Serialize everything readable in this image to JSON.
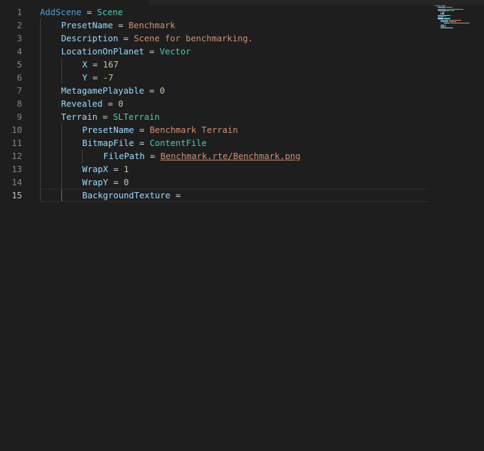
{
  "editor": {
    "lines": [
      {
        "number": "1",
        "indent": 0,
        "key": "AddScene",
        "key_class": "tok-top",
        "op": " = ",
        "value": "Scene",
        "value_class": "tok-type"
      },
      {
        "number": "2",
        "indent": 1,
        "key": "PresetName",
        "key_class": "tok-key",
        "op": " = ",
        "value": "Benchmark",
        "value_class": "tok-str"
      },
      {
        "number": "3",
        "indent": 1,
        "key": "Description",
        "key_class": "tok-key",
        "op": " = ",
        "value": "Scene for benchmarking.",
        "value_class": "tok-str"
      },
      {
        "number": "4",
        "indent": 1,
        "key": "LocationOnPlanet",
        "key_class": "tok-key",
        "op": " = ",
        "value": "Vector",
        "value_class": "tok-type"
      },
      {
        "number": "5",
        "indent": 2,
        "key": "X",
        "key_class": "tok-key",
        "op": " = ",
        "value": "167",
        "value_class": "tok-num"
      },
      {
        "number": "6",
        "indent": 2,
        "key": "Y",
        "key_class": "tok-key",
        "op": " = ",
        "value": "-7",
        "value_class": "tok-num"
      },
      {
        "number": "7",
        "indent": 1,
        "key": "MetagamePlayable",
        "key_class": "tok-key",
        "op": " = ",
        "value": "0",
        "value_class": "tok-num"
      },
      {
        "number": "8",
        "indent": 1,
        "key": "Revealed",
        "key_class": "tok-key",
        "op": " = ",
        "value": "0",
        "value_class": "tok-num"
      },
      {
        "number": "9",
        "indent": 1,
        "key": "Terrain",
        "key_class": "tok-key",
        "op": " = ",
        "value": "SLTerrain",
        "value_class": "tok-type"
      },
      {
        "number": "10",
        "indent": 2,
        "key": "PresetName",
        "key_class": "tok-key",
        "op": " = ",
        "value": "Benchmark Terrain",
        "value_class": "tok-str"
      },
      {
        "number": "11",
        "indent": 2,
        "key": "BitmapFile",
        "key_class": "tok-key",
        "op": " = ",
        "value": "ContentFile",
        "value_class": "tok-type"
      },
      {
        "number": "12",
        "indent": 3,
        "key": "FilePath",
        "key_class": "tok-key",
        "op": " = ",
        "value": "Benchmark.rte/Benchmark.png",
        "value_class": "tok-link"
      },
      {
        "number": "13",
        "indent": 2,
        "key": "WrapX",
        "key_class": "tok-key",
        "op": " = ",
        "value": "1",
        "value_class": "tok-num"
      },
      {
        "number": "14",
        "indent": 2,
        "key": "WrapY",
        "key_class": "tok-key",
        "op": " = ",
        "value": "0",
        "value_class": "tok-num"
      },
      {
        "number": "15",
        "indent": 2,
        "key": "BackgroundTexture",
        "key_class": "tok-key",
        "op": " =",
        "value": "",
        "value_class": "tok-op",
        "current": true
      }
    ]
  },
  "colors": {
    "background": "#1e1e1e",
    "line_number": "#858585",
    "line_number_active": "#c6c6c6",
    "key": "#9cdcfe",
    "top_keyword": "#569cd6",
    "type": "#4ec9b0",
    "string": "#ce9178",
    "number": "#b5cea8"
  }
}
